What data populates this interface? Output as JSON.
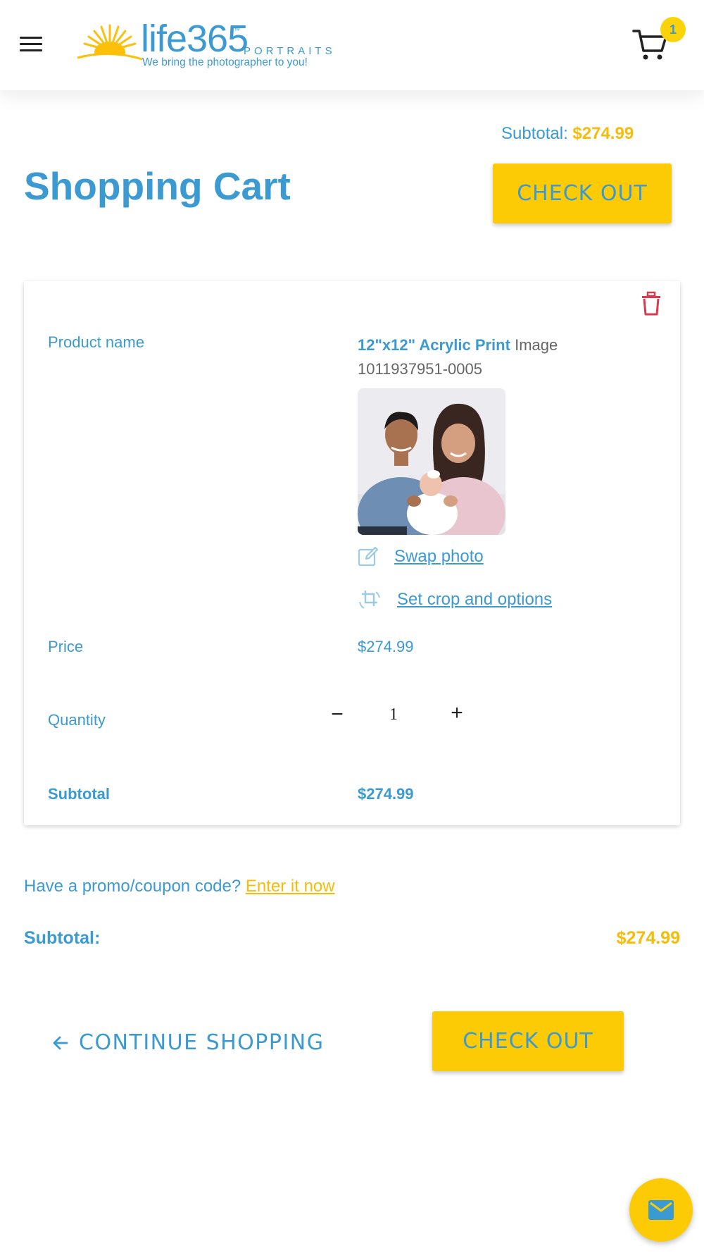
{
  "header": {
    "logo": {
      "brand": "life365",
      "trademark": "™",
      "sub": "PORTRAITS",
      "tagline": "We bring the photographer to you!"
    },
    "cart_count": "1",
    "icons": {
      "menu": "hamburger-menu-icon",
      "cart": "shopping-cart-icon"
    }
  },
  "top": {
    "subtotal_label": "Subtotal:",
    "subtotal_value": "$274.99",
    "page_title": "Shopping Cart",
    "checkout_label": "CHECK OUT"
  },
  "item": {
    "product_name_label": "Product name",
    "product_name": "12\"x12\" Acrylic Print",
    "image_label": "Image",
    "image_id": "1011937951-0005",
    "swap_photo_label": "Swap photo",
    "crop_label": "Set crop and options",
    "price_label": "Price",
    "price_value": "$274.99",
    "quantity_label": "Quantity",
    "quantity_minus": "−",
    "quantity_value": "1",
    "quantity_plus": "+",
    "subtotal_label": "Subtotal",
    "subtotal_value": "$274.99"
  },
  "summary": {
    "promo_text": "Have a promo/coupon code?",
    "promo_link": "Enter it now",
    "subtotal_label": "Subtotal:",
    "subtotal_value": "$274.99",
    "continue_label": "CONTINUE SHOPPING",
    "checkout_label": "CHECK OUT"
  },
  "colors": {
    "primary_blue": "#3a9ad1",
    "accent_yellow": "#fdcb05",
    "price_yellow": "#f5bd0a",
    "delete_red": "#d83a4e"
  }
}
